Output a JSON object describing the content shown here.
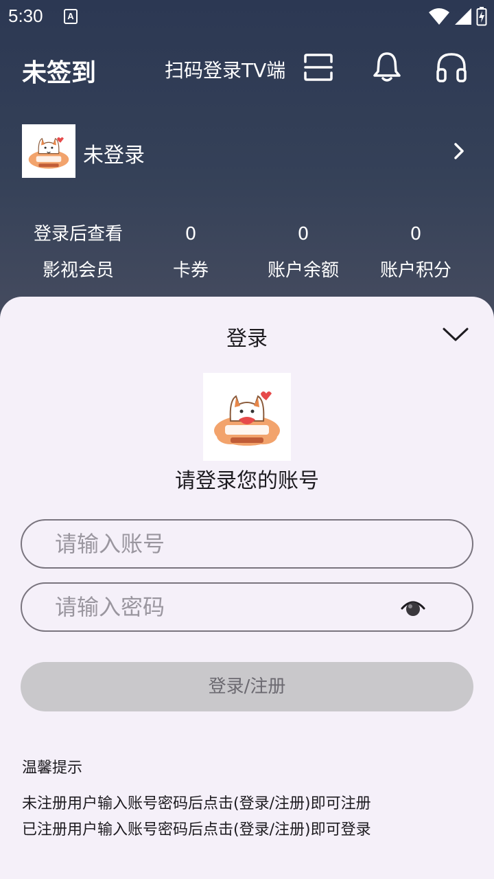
{
  "status_bar": {
    "time": "5:30",
    "notification_letter": "A"
  },
  "header": {
    "sign_status": "未签到",
    "scan_login_label": "扫码登录TV端"
  },
  "profile": {
    "login_state": "未登录"
  },
  "stats": [
    {
      "value": "登录后查看",
      "label": "影视会员"
    },
    {
      "value": "0",
      "label": "卡券"
    },
    {
      "value": "0",
      "label": "账户余额"
    },
    {
      "value": "0",
      "label": "账户积分"
    }
  ],
  "login_sheet": {
    "title": "登录",
    "prompt": "请登录您的账号",
    "account_placeholder": "请输入账号",
    "password_placeholder": "请输入密码",
    "submit_label": "登录/注册",
    "tips_title": "温馨提示",
    "tips_lines": [
      "未注册用户输入账号密码后点击(登录/注册)即可注册",
      "已注册用户输入账号密码后点击(登录/注册)即可登录"
    ]
  },
  "colors": {
    "header_bg": "#2c3853",
    "sheet_bg": "#f5f0f9",
    "button_disabled": "#c9c8cb",
    "field_border": "#79747e"
  }
}
